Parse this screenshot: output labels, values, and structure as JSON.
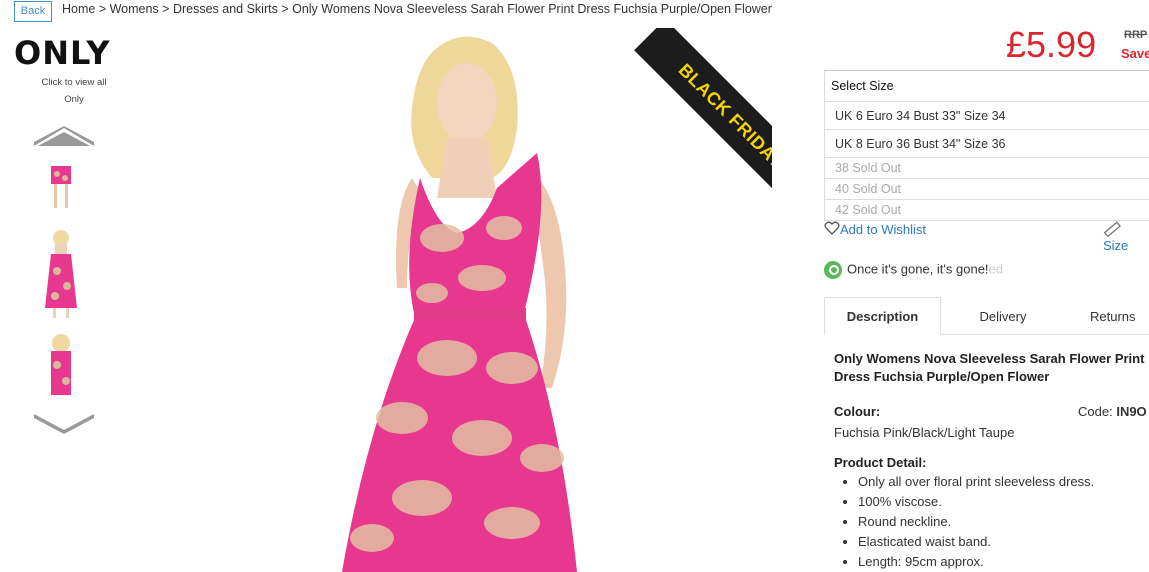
{
  "breadcrumb": {
    "back_label": "Back",
    "items": [
      "Home",
      "Womens",
      "Dresses and Skirts",
      "Only Womens Nova Sleeveless Sarah Flower Print Dress Fuchsia Purple/Open Flower"
    ],
    "separator": " > "
  },
  "brand": {
    "logo_text": "ONLY",
    "click_to_view": "Click to view all",
    "brand_name": "Only"
  },
  "gallery": {
    "thumbnails": [
      "dress-back-full",
      "dress-front-full",
      "dress-back-upper"
    ],
    "up_icon": "chevron-up-icon",
    "down_icon": "chevron-down-icon"
  },
  "promo": {
    "ribbon_text": "BLACK FRIDAY"
  },
  "price": {
    "current": "£5.99",
    "rrp_label": "RRP",
    "save_label": "Save"
  },
  "sizes": {
    "header": "Select Size",
    "options": [
      {
        "label": "UK 6 Euro 34 Bust 33\" Size 34",
        "sold": false
      },
      {
        "label": "UK 8 Euro 36 Bust 34\" Size 36",
        "sold": false
      },
      {
        "label": "38 Sold Out",
        "sold": true
      },
      {
        "label": "40 Sold Out",
        "sold": true
      },
      {
        "label": "42 Sold Out",
        "sold": true
      }
    ]
  },
  "actions": {
    "wishlist": "Add to Wishlist",
    "size_guide": "Size"
  },
  "notice": {
    "text": "Once it's gone, it's gone!",
    "faded_suffix": "ed"
  },
  "tabs": [
    "Description",
    "Delivery",
    "Returns"
  ],
  "description": {
    "title": "Only Womens Nova Sleeveless Sarah Flower Print Dress Fuchsia Purple/Open Flower",
    "colour_label": "Colour:",
    "colour_value": "Fuchsia Pink/Black/Light Taupe",
    "code_label": "Code:",
    "code_value": "IN9O",
    "detail_label": "Product Detail:",
    "details": [
      "Only all over floral print sleeveless dress.",
      "100% viscose.",
      "Round neckline.",
      "Elasticated waist band.",
      "Length: 95cm approx."
    ]
  },
  "colors": {
    "price_red": "#d9262f",
    "link_blue": "#2a7bc0",
    "dress_pink": "#e8378f",
    "ribbon_yellow": "#f5d400"
  }
}
